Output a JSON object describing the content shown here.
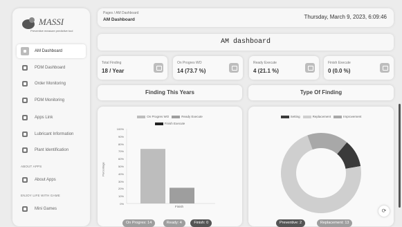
{
  "brand": {
    "name": "MASSI",
    "tagline": "Preventive measure predictive tool"
  },
  "sidebar": {
    "items": [
      {
        "label": "AM Dashboard",
        "icon": "square-icon",
        "active": true
      },
      {
        "label": "PDM Dashboard",
        "icon": "chart-icon"
      },
      {
        "label": "Order Monitoring",
        "icon": "list-icon"
      },
      {
        "label": "PDM Monitoring",
        "icon": "monitor-icon"
      },
      {
        "label": "Apps Link",
        "icon": "link-icon"
      },
      {
        "label": "Lubricant Information",
        "icon": "drop-icon"
      },
      {
        "label": "Plant Identification",
        "icon": "factory-icon"
      }
    ],
    "section_about": "ABOUT APPS",
    "about_item": {
      "label": "About Apps",
      "icon": "info-icon"
    },
    "section_games": "ENJOY LIFE WITH GAME",
    "games_item": {
      "label": "Mini Games",
      "icon": "game-icon"
    }
  },
  "topbar": {
    "breadcrumb": "Pages / AM Dashboard",
    "title": "AM Dashboard",
    "datetime": "Thursday, March 9, 2023, 6:09:46"
  },
  "header": {
    "title": "AM dashboard"
  },
  "stats": [
    {
      "label": "Total Finding",
      "value": "18 / Year"
    },
    {
      "label": "On Progres WO",
      "value": "14 (73.7 %)"
    },
    {
      "label": "Ready Execute",
      "value": "4 (21.1 %)"
    },
    {
      "label": "Finish Execute",
      "value": "0 (0.0 %)"
    }
  ],
  "panels": {
    "left_title": "Finding This Years",
    "right_title": "Type Of Finding"
  },
  "colors": {
    "on_progres": "#bdbdbd",
    "ready": "#9e9e9e",
    "finish": "#222222",
    "setting": "#3a3a3a",
    "replacement": "#cfcfcf",
    "improvement": "#a8a8a8"
  },
  "chart_data": [
    {
      "type": "bar",
      "categories": [
        "Finish"
      ],
      "series": [
        {
          "name": "On Progres WO",
          "values": [
            73
          ]
        },
        {
          "name": "Ready Execute",
          "values": [
            21
          ]
        },
        {
          "name": "Finish Execute",
          "values": [
            0
          ]
        }
      ],
      "ylabel": "Percentage",
      "yticks": [
        "100%",
        "90%",
        "80%",
        "70%",
        "60%",
        "50%",
        "40%",
        "30%",
        "20%",
        "10%",
        "0%"
      ],
      "ylim": [
        0,
        100
      ],
      "legend_position": "top"
    },
    {
      "type": "pie",
      "labels": [
        "Setting",
        "Replacement",
        "Improvement"
      ],
      "values": [
        2,
        13,
        3
      ],
      "donut": true,
      "legend_position": "top"
    }
  ],
  "pills_left": [
    "On Progres: 14",
    "Ready: 4",
    "Finish: 0"
  ],
  "pills_right": [
    "Preventive: 2",
    "Replacement: 13"
  ]
}
